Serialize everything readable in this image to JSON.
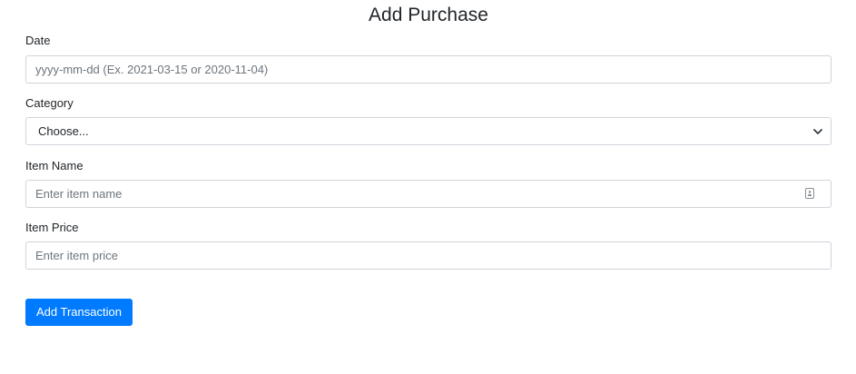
{
  "header": {
    "title": "Add Purchase"
  },
  "form": {
    "date": {
      "label": "Date",
      "placeholder": "yyyy-mm-dd (Ex. 2021-03-15 or 2020-11-04)",
      "value": ""
    },
    "category": {
      "label": "Category",
      "selected": "Choose...",
      "icon": "chevron-down-icon"
    },
    "item_name": {
      "label": "Item Name",
      "placeholder": "Enter item name",
      "value": "",
      "icon": "autofill-contact-icon"
    },
    "item_price": {
      "label": "Item Price",
      "placeholder": "Enter item price",
      "value": ""
    },
    "submit_label": "Add Transaction"
  },
  "colors": {
    "primary": "#007bff",
    "border": "#ced4da",
    "text": "#212529",
    "placeholder": "#6c757d"
  }
}
